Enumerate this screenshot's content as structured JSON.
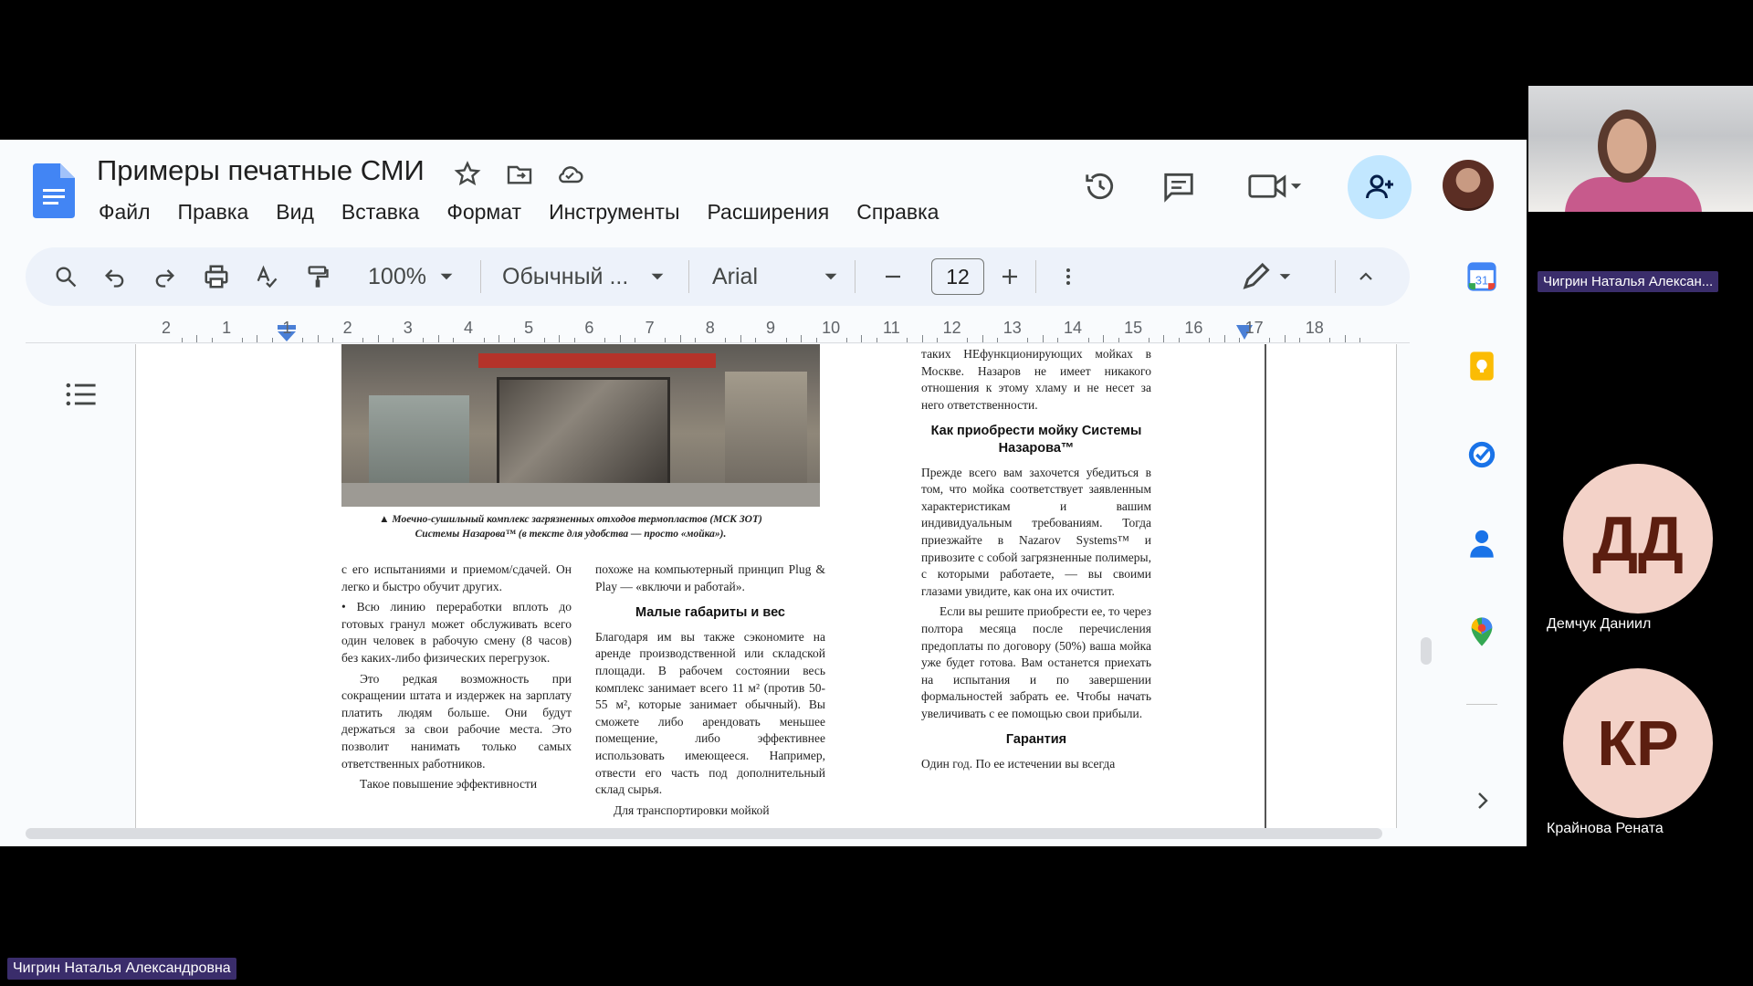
{
  "doc": {
    "title": "Примеры печатные СМИ",
    "menu": [
      "Файл",
      "Правка",
      "Вид",
      "Вставка",
      "Формат",
      "Инструменты",
      "Расширения",
      "Справка"
    ]
  },
  "toolbar": {
    "zoom": "100%",
    "style": "Обычный ...",
    "font": "Arial",
    "font_size": "12"
  },
  "ruler": {
    "labels": [
      "2",
      "1",
      "1",
      "2",
      "3",
      "4",
      "5",
      "6",
      "7",
      "8",
      "9",
      "10",
      "11",
      "12",
      "13",
      "14",
      "15",
      "16",
      "17",
      "18"
    ]
  },
  "article": {
    "caption_line1": "▲ Моечно-сушильный комплекс загрязненных отходов термопластов (МСК ЗОТ)",
    "caption_line2": "Системы Назарова™ (в тексте для удобства — просто «мойка»).",
    "right_p0": "таких НЕфункционирующих мойках в Москве. Назаров не имеет никакого отношения к этому хламу и не несет за него ответственности.",
    "right_h1": "Как приобрести мойку Системы Назарова™",
    "right_p1": "Прежде всего вам захочется убедиться в том, что мойка соответствует заявленным характеристикам и вашим индивидуальным требованиям. Тогда приезжайте в Nazarov Systems™ и привозите с собой загрязненные полимеры, с которыми работаете, — вы своими глазами увидите, как она их очистит.",
    "right_p2": "Если вы решите приобрести ее, то через полтора месяца после перечисления предоплаты по договору (50%) ваша мойка уже будет готова. Вам останется приехать на испытания и по завершении формальностей забрать ее. Чтобы начать увеличивать с ее помощью свои прибыли.",
    "right_h2": "Гарантия",
    "right_p3": "Один год. По ее истечении вы всегда",
    "left_p1": "с его испытаниями и приемом/сдачей. Он легко и быстро обучит других.",
    "left_p2": "• Всю линию переработки вплоть до готовых гранул может обслуживать всего один человек в рабочую смену (8 часов) без каких-либо физических перегрузок.",
    "left_p3": "Это редкая возможность при сокращении штата и издержек на зарплату платить людям больше. Они будут держаться за свои рабочие места. Это позволит нанимать только самых ответственных работников.",
    "left_p4": "Такое повышение эффективности",
    "mid_p1": "похоже на компьютерный принцип Plug & Play — «включи и работай».",
    "mid_h1": "Малые габариты и вес",
    "mid_p2": "Благодаря им вы также сэкономите на аренде производственной или складской площади. В рабочем состоянии весь комплекс занимает всего 11 м² (против 50-55 м², которые занимает обычный). Вы сможете либо арендовать меньшее помещение, либо эффективнее использовать имеющееся. Например, отвести его часть под дополнительный склад сырья.",
    "mid_p3": "Для транспортировки мойкой"
  },
  "meeting": {
    "presenter_tile_name": "Чигрин Наталья Алексан...",
    "presenter_full_name": "Чигрин Наталья Александровна",
    "participants": [
      {
        "initials": "ДД",
        "name": "Демчук Даниил"
      },
      {
        "initials": "КР",
        "name": "Крайнова Рената"
      }
    ]
  },
  "icons": [
    "docs-logo",
    "star-icon",
    "move-folder-icon",
    "cloud-status-icon",
    "history-icon",
    "comments-icon",
    "meet-icon",
    "share-icon",
    "search-icon",
    "undo-icon",
    "redo-icon",
    "print-icon",
    "spellcheck-icon",
    "paint-format-icon",
    "more-icon",
    "edit-mode-icon",
    "collapse-icon",
    "outline-icon",
    "calendar-icon",
    "keep-icon",
    "tasks-icon",
    "contacts-icon",
    "maps-icon",
    "expand-panel-icon"
  ],
  "colors": {
    "accent": "#0b57d0",
    "share_bg": "#c2e7ff",
    "name_tag": "#3a2d6b",
    "avatar_bg": "#f3d2c8"
  }
}
